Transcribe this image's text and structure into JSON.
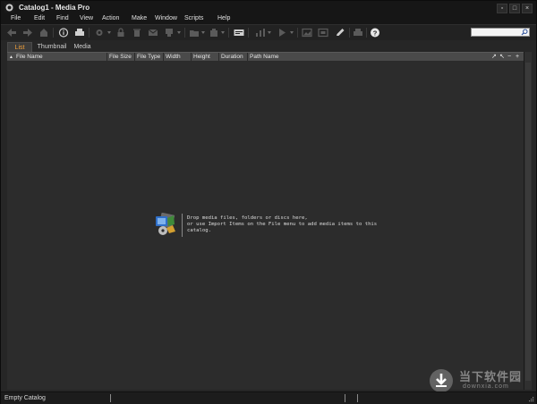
{
  "window": {
    "title": "Catalog1 - Media Pro",
    "controls": {
      "minimize": "▫",
      "maximize": "□",
      "close": "×"
    }
  },
  "menu": [
    "File",
    "Edit",
    "Find",
    "View",
    "Action",
    "Make",
    "Window",
    "Scripts",
    "Help"
  ],
  "toolbar": {
    "icons": [
      "back-arrow-icon",
      "forward-arrow-icon",
      "home-icon",
      "info-icon",
      "print-icon",
      "gear-icon",
      "lock-icon",
      "trash-icon",
      "mail-icon",
      "import-icon",
      "folder-icon",
      "catalog-icon",
      "slide-icon",
      "chart-icon",
      "play-icon",
      "image-icon",
      "frame-icon",
      "pencil-icon",
      "printer-icon",
      "help-icon"
    ],
    "search": {
      "placeholder": "",
      "value": ""
    }
  },
  "tabs": [
    {
      "label": "List",
      "active": true
    },
    {
      "label": "Thumbnail",
      "active": false
    },
    {
      "label": "Media",
      "active": false
    }
  ],
  "columns": [
    "File Name",
    "File Size",
    "File Type",
    "Width",
    "Height",
    "Duration",
    "Path Name"
  ],
  "column_sort_indicator": "▲",
  "header_controls": [
    "↗",
    "↖",
    "−",
    "+"
  ],
  "drop_message": {
    "line1": "Drop media files, folders or discs here,",
    "line2": "or use Import Items on the File menu to add media items to this",
    "line3": "catalog."
  },
  "status": {
    "text": "Empty Catalog"
  },
  "watermark": {
    "title": "当下软件园",
    "url": "downxia.com"
  },
  "colors": {
    "background": "#262626",
    "list_background": "#2c2c2c",
    "header_background": "#4a4a4a",
    "active_tab_text": "#f2a13a"
  }
}
